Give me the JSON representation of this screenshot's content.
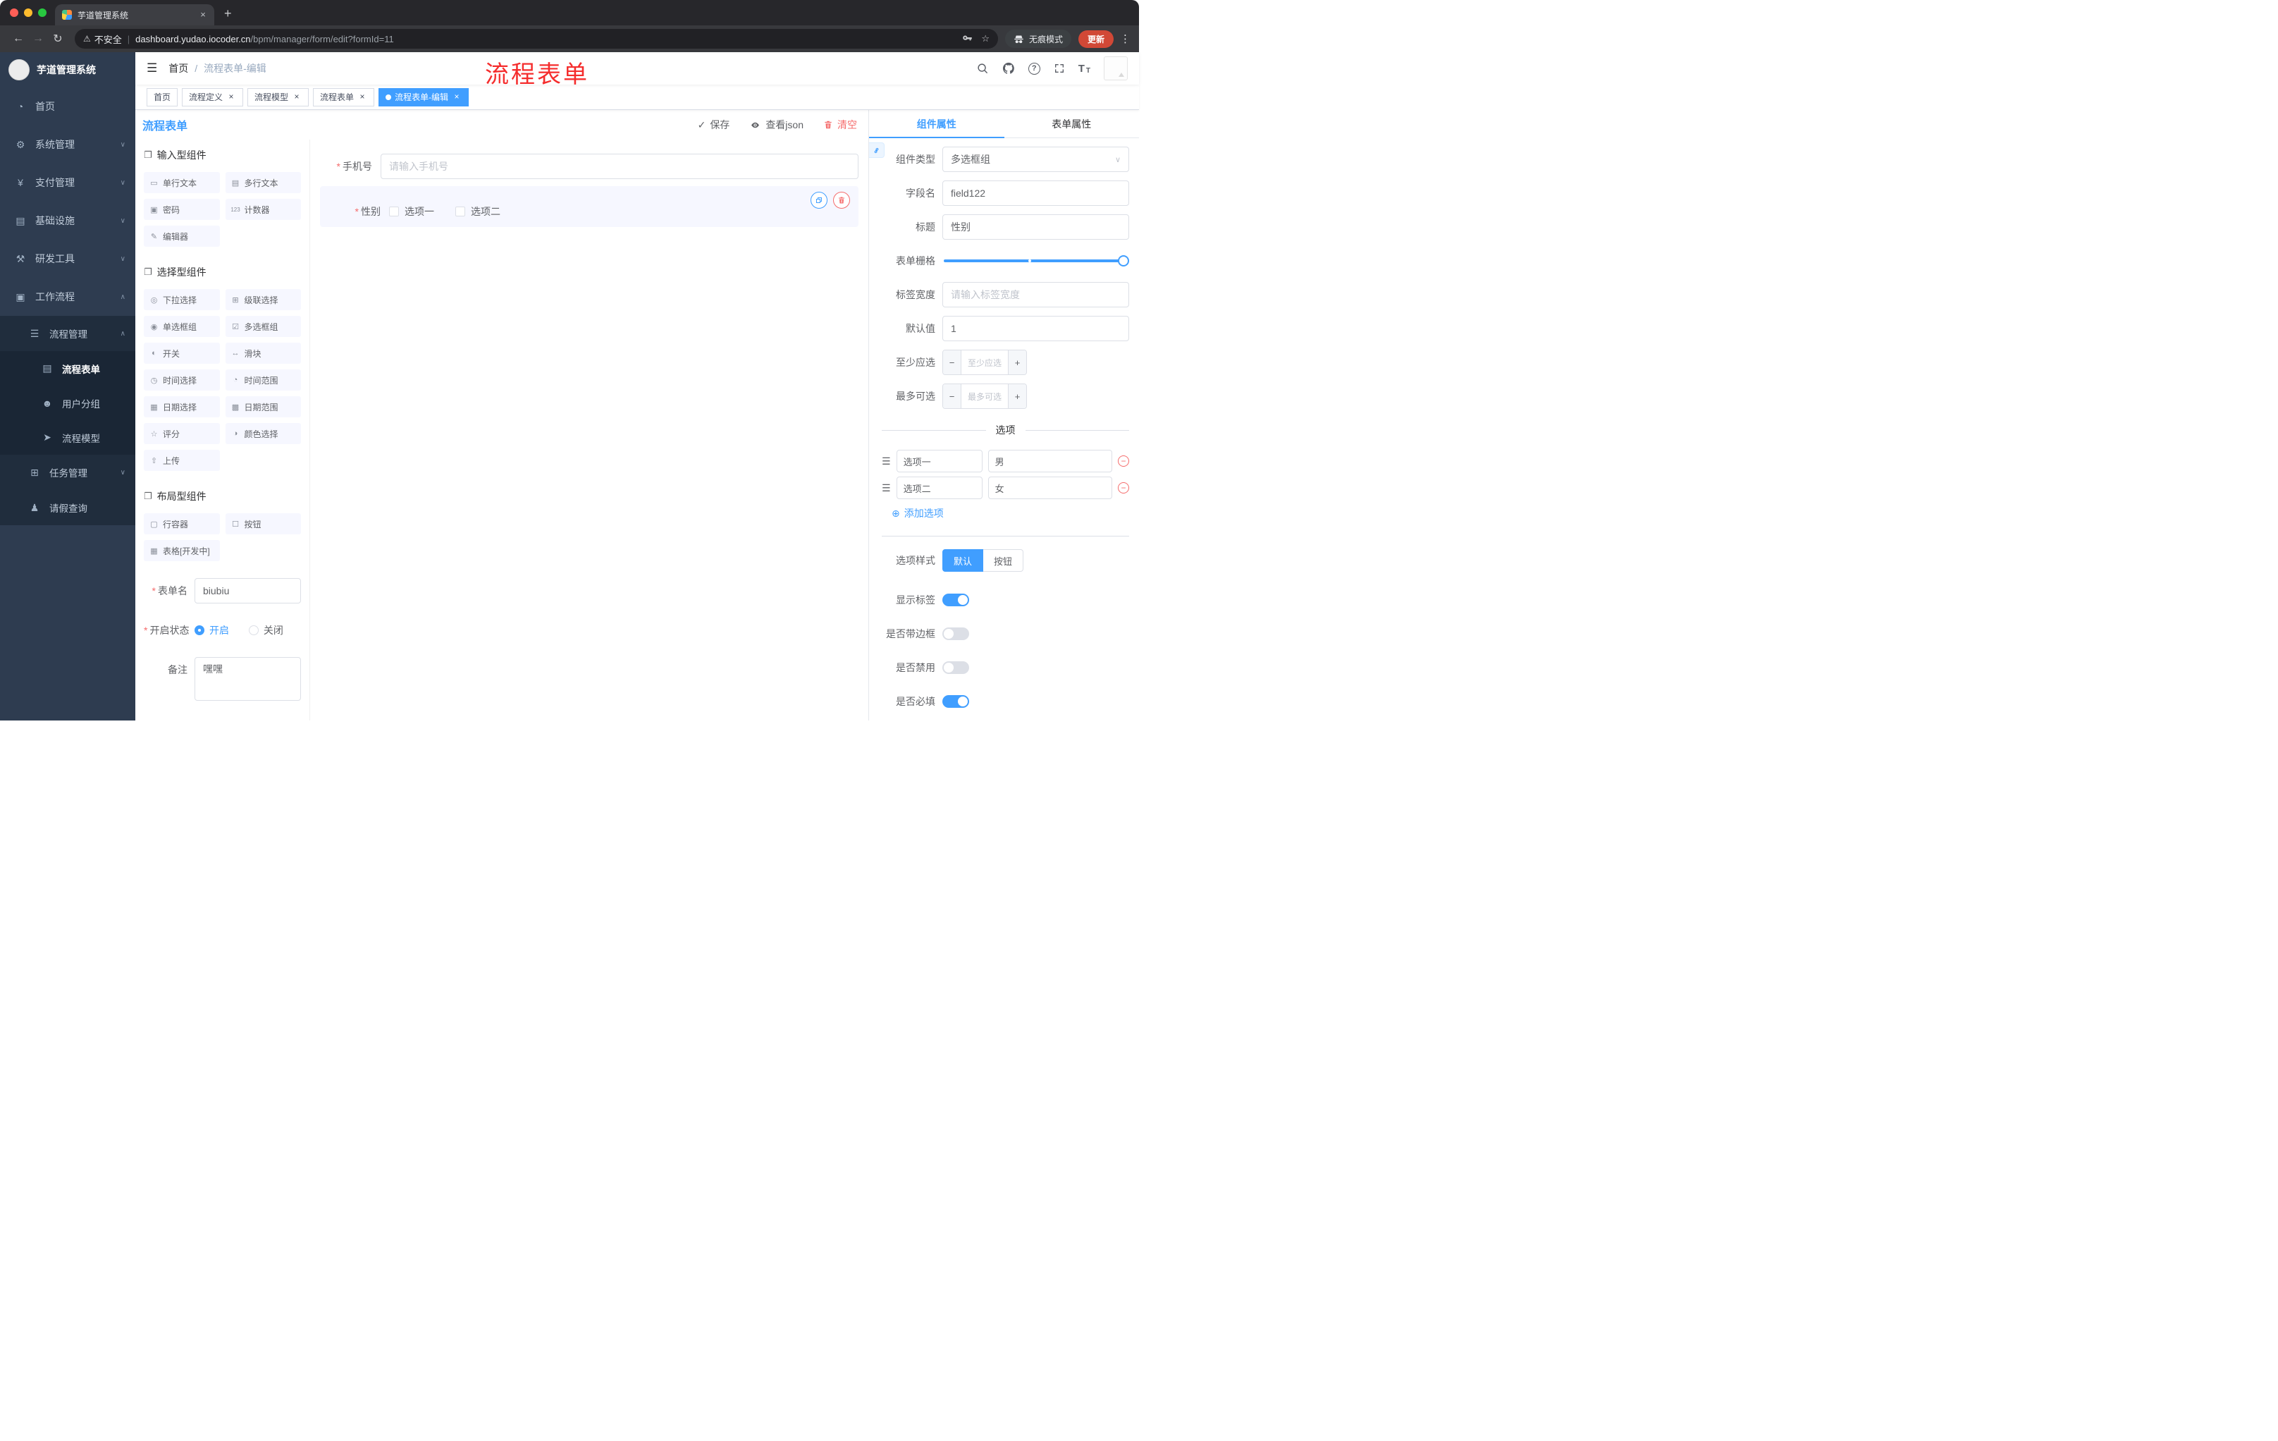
{
  "icons": {
    "back": "←",
    "forward": "→",
    "reload": "↻",
    "warning": "⚠",
    "pipe": "|",
    "star": "☆",
    "menu_dots": "⋮",
    "close": "×",
    "new_tab": "+",
    "hamburger": "☰",
    "slash": "/",
    "check": "✓",
    "chevron_down": "∨",
    "chevron_up": "∧",
    "select_arrow": "∨",
    "group": "❐",
    "drag": "☰",
    "minus": "−",
    "plus": "+",
    "add": "⊕",
    "question": "?",
    "required": "*",
    "font_size_large": "T",
    "font_size_small": "T"
  },
  "browser": {
    "tab_title": "芋道管理系统",
    "security_label": "不安全",
    "url_domain": "dashboard.yudao.iocoder.cn",
    "url_path": "/bpm/manager/form/edit?formId=11",
    "incognito_label": "无痕模式",
    "update_label": "更新"
  },
  "sidebar": {
    "app_title": "芋道管理系统",
    "menu": [
      {
        "icon": "◔",
        "label": "首页"
      },
      {
        "icon": "⚙",
        "label": "系统管理"
      },
      {
        "icon": "¥",
        "label": "支付管理"
      },
      {
        "icon": "▤",
        "label": "基础设施"
      },
      {
        "icon": "⚒",
        "label": "研发工具"
      },
      {
        "icon": "▣",
        "label": "工作流程"
      }
    ],
    "process_group": {
      "icon": "☰",
      "label": "流程管理"
    },
    "process_children": [
      {
        "icon": "▤",
        "label": "流程表单"
      },
      {
        "icon": "☻",
        "label": "用户分组"
      },
      {
        "icon": "➤",
        "label": "流程模型"
      }
    ],
    "task_group": {
      "icon": "⊞",
      "label": "任务管理"
    },
    "leave_item": {
      "icon": "♟",
      "label": "请假查询"
    }
  },
  "header": {
    "breadcrumb_home": "首页",
    "breadcrumb_current": "流程表单-编辑",
    "annotation": "流程表单"
  },
  "tags": [
    {
      "label": "首页",
      "closable": false,
      "active": false
    },
    {
      "label": "流程定义",
      "closable": true,
      "active": false
    },
    {
      "label": "流程模型",
      "closable": true,
      "active": false
    },
    {
      "label": "流程表单",
      "closable": true,
      "active": false
    },
    {
      "label": "流程表单-编辑",
      "closable": true,
      "active": true
    }
  ],
  "designer": {
    "title": "流程表单",
    "save": "保存",
    "view_json": "查看json",
    "clear": "清空"
  },
  "palette": {
    "groups": [
      {
        "title": "输入型组件",
        "items": [
          {
            "icon": "▭",
            "label": "单行文本"
          },
          {
            "icon": "▤",
            "label": "多行文本"
          },
          {
            "icon": "▣",
            "label": "密码"
          },
          {
            "icon": "123",
            "label": "计数器"
          },
          {
            "icon": "✎",
            "label": "编辑器"
          }
        ]
      },
      {
        "title": "选择型组件",
        "items": [
          {
            "icon": "◎",
            "label": "下拉选择"
          },
          {
            "icon": "⊞",
            "label": "级联选择"
          },
          {
            "icon": "◉",
            "label": "单选框组"
          },
          {
            "icon": "☑",
            "label": "多选框组"
          },
          {
            "icon": "◐",
            "label": "开关"
          },
          {
            "icon": "↔",
            "label": "滑块"
          },
          {
            "icon": "◷",
            "label": "时间选择"
          },
          {
            "icon": "◔",
            "label": "时间范围"
          },
          {
            "icon": "▦",
            "label": "日期选择"
          },
          {
            "icon": "▩",
            "label": "日期范围"
          },
          {
            "icon": "☆",
            "label": "评分"
          },
          {
            "icon": "◑",
            "label": "颜色选择"
          },
          {
            "icon": "⇧",
            "label": "上传"
          }
        ]
      },
      {
        "title": "布局型组件",
        "items": [
          {
            "icon": "▢",
            "label": "行容器"
          },
          {
            "icon": "☐",
            "label": "按钮"
          },
          {
            "icon": "▦",
            "label": "表格[开发中]"
          }
        ]
      }
    ]
  },
  "form_meta": {
    "name_label": "表单名",
    "name_value": "biubiu",
    "status_label": "开启状态",
    "status_on": "开启",
    "status_off": "关闭",
    "remark_label": "备注",
    "remark_value": "嘿嘿"
  },
  "canvas": {
    "phone_label": "手机号",
    "phone_placeholder": "请输入手机号",
    "gender_label": "性别",
    "gender_option1": "选项一",
    "gender_option2": "选项二"
  },
  "props": {
    "tab_component": "组件属性",
    "tab_form": "表单属性",
    "type_label": "组件类型",
    "type_value": "多选框组",
    "field_label": "字段名",
    "field_value": "field122",
    "title_label": "标题",
    "title_value": "性别",
    "grid_label": "表单栅格",
    "label_width_label": "标签宽度",
    "label_width_placeholder": "请输入标签宽度",
    "default_label": "默认值",
    "default_value": "1",
    "min_label": "至少应选",
    "min_placeholder": "至少应选",
    "max_label": "最多可选",
    "max_placeholder": "最多可选",
    "options_title": "选项",
    "options": [
      {
        "label": "选项一",
        "value": "男"
      },
      {
        "label": "选项二",
        "value": "女"
      }
    ],
    "add_option": "添加选项",
    "style_label": "选项样式",
    "style_default": "默认",
    "style_button": "按钮",
    "switches": [
      {
        "label": "显示标签",
        "on": true
      },
      {
        "label": "是否带边框",
        "on": false
      },
      {
        "label": "是否禁用",
        "on": false
      },
      {
        "label": "是否必填",
        "on": true
      }
    ]
  },
  "colors": {
    "accent": "#409eff",
    "danger": "#f56c6c",
    "annotation_red": "#f52d2d",
    "sidebar_bg": "#2e3c50",
    "sidebar_submenu_bg": "#202d3d",
    "tag_active_bg": "#409eff"
  }
}
